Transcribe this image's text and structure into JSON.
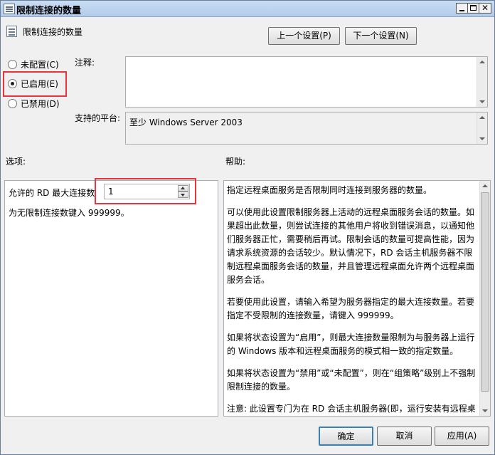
{
  "window": {
    "title": "限制连接的数量"
  },
  "header": {
    "setting_name": "限制连接的数量",
    "prev_label": "上一个设置(P)",
    "next_label": "下一个设置(N)"
  },
  "state": {
    "options": [
      {
        "label": "未配置(C)",
        "selected": false
      },
      {
        "label": "已启用(E)",
        "selected": true
      },
      {
        "label": "已禁用(D)",
        "selected": false
      }
    ]
  },
  "comment": {
    "label": "注释:",
    "value": ""
  },
  "platform": {
    "label": "支持的平台:",
    "value": "至少 Windows Server 2003"
  },
  "options_section": {
    "label": "选项:",
    "max_label": "允许的 RD 最大连接数",
    "max_value": "1",
    "hint": "为无限制连接数键入 999999。"
  },
  "help_section": {
    "label": "帮助:",
    "paragraphs": [
      "指定远程桌面服务是否限制同时连接到服务器的数量。",
      "可以使用此设置限制服务器上活动的远程桌面服务会话的数量。如果超出此数量，则尝试连接的其他用户将收到错误消息，以通知他们服务器正忙，需要稍后再试。限制会话的数量可提高性能，因为请求系统资源的会话较少。默认情况下，RD 会话主机服务器不限制远程桌面服务会话的数量，并且管理远程桌面允许两个远程桌面服务会话。",
      "若要使用此设置，请输入希望为服务器指定的最大连接数量。若要指定不受限制的连接数量，请键入 999999。",
      "如果将状态设置为“启用”，则最大连接数量限制为与服务器上运行的 Windows 版本和远程桌面服务的模式相一致的指定数量。",
      "如果将状态设置为“禁用”或“未配置”，则在“组策略”级别上不强制限制连接的数量。",
      "注意: 此设置专门为在 RD 会话主机服务器(即，运行安装有远程桌"
    ]
  },
  "footer": {
    "ok": "确定",
    "cancel": "取消",
    "apply": "应用(A)"
  }
}
